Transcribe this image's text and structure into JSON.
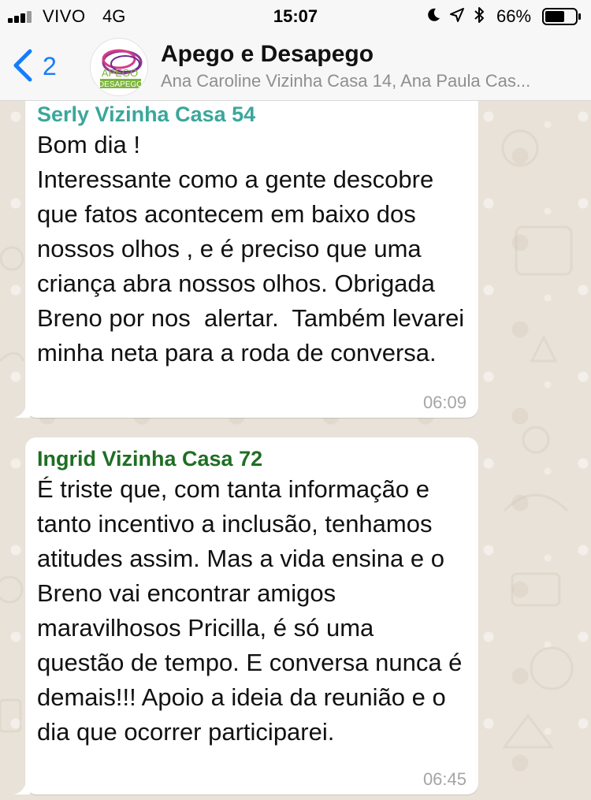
{
  "status_bar": {
    "carrier": "VIVO",
    "network": "4G",
    "time": "15:07",
    "battery": "66%",
    "battery_level": 0.66,
    "icons": [
      "signal-icon",
      "moon-icon",
      "location-icon",
      "bluetooth-icon",
      "battery-icon"
    ]
  },
  "header": {
    "back_count": "2",
    "title": "Apego e Desapego",
    "subtitle": "Ana Caroline Vizinha Casa 14, Ana Paula Cas...",
    "avatar_text_top": "APEGO",
    "avatar_text_bottom": "DESAPEGO"
  },
  "messages": [
    {
      "sender": "Serly Vizinha Casa 54",
      "text": "Bom dia !\nInteressante como a gente descobre que fatos acontecem em baixo dos nossos olhos , e é preciso que uma criança abra nossos olhos. Obrigada Breno por nos  alertar.  Também levarei minha neta para a roda de conversa.",
      "time": "06:09",
      "sender_color": "#3aa79b"
    },
    {
      "sender": "Ingrid Vizinha Casa 72",
      "text": "É triste que, com tanta informação e tanto incentivo a inclusão, tenhamos atitudes assim. Mas a vida ensina e o Breno vai encontrar amigos maravilhosos Pricilla, é só uma questão de tempo. E conversa nunca é demais!!! Apoio a ideia da reunião e o dia que ocorrer participarei.",
      "time": "06:45",
      "sender_color": "#1f6e23"
    }
  ],
  "colors": {
    "accent": "#147efb",
    "wallpaper": "#ece5dd",
    "bubble": "#ffffff"
  }
}
